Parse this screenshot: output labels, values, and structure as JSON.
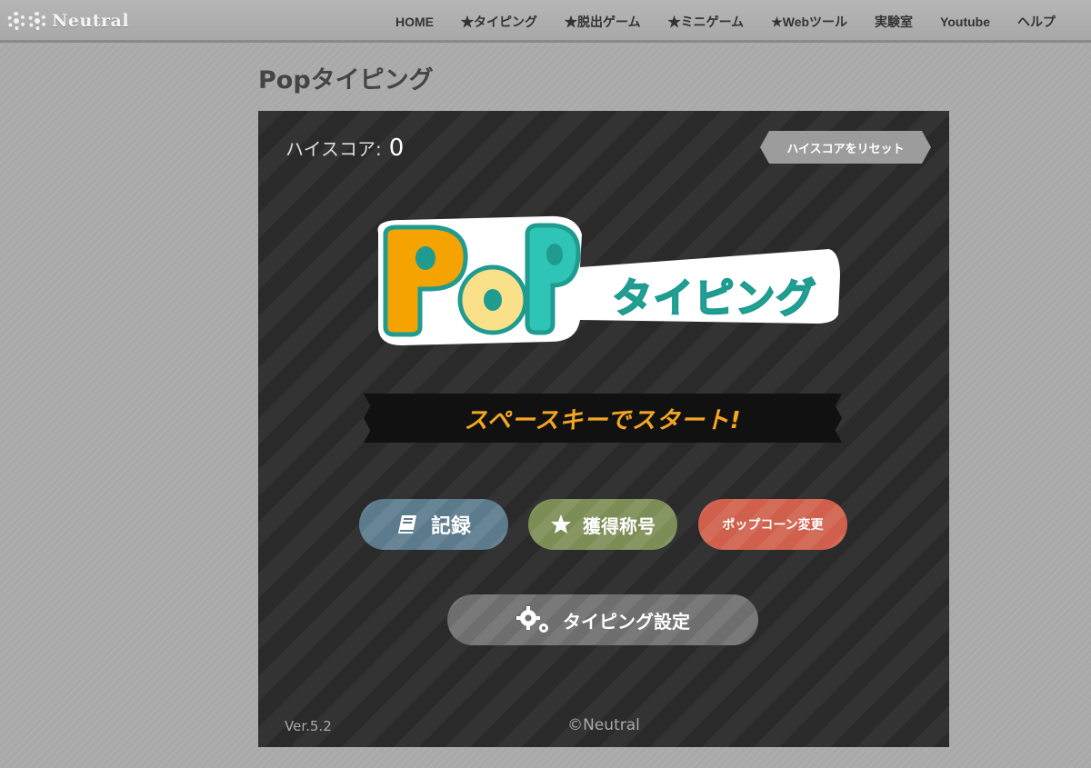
{
  "site": {
    "logo_text": "Neutral",
    "nav": [
      {
        "label": "HOME"
      },
      {
        "label": "★タイピング"
      },
      {
        "label": "★脱出ゲーム"
      },
      {
        "label": "★ミニゲーム"
      },
      {
        "label": "★Webツール"
      },
      {
        "label": "実験室"
      },
      {
        "label": "Youtube"
      },
      {
        "label": "ヘルプ"
      }
    ]
  },
  "page": {
    "title": "Popタイピング"
  },
  "game": {
    "highscore_label": "ハイスコア:",
    "highscore_value": "0",
    "reset_button": "ハイスコアをリセット",
    "logo": {
      "main": "PoP",
      "sub": "タイピング"
    },
    "start_prompt": "スペースキーでスタート!",
    "buttons": {
      "record": "記録",
      "titles": "獲得称号",
      "popcorn": "ポップコーン変更",
      "settings": "タイピング設定"
    },
    "version": "Ver.5.2",
    "copyright": "©Neutral"
  },
  "colors": {
    "record_btn": "#5b7b8d",
    "titles_btn": "#7d8d56",
    "popcorn_btn": "#d0604c",
    "settings_btn": "#6e6e6e",
    "start_text": "#f4a623",
    "logo_orange": "#f5a300",
    "logo_cream": "#fbe08a",
    "logo_teal": "#2ec4b6",
    "logo_outline": "#1f9b8f"
  },
  "icons": {
    "record": "book-icon",
    "titles": "star-icon",
    "settings": "gears-icon",
    "logo": "gear-icon"
  }
}
